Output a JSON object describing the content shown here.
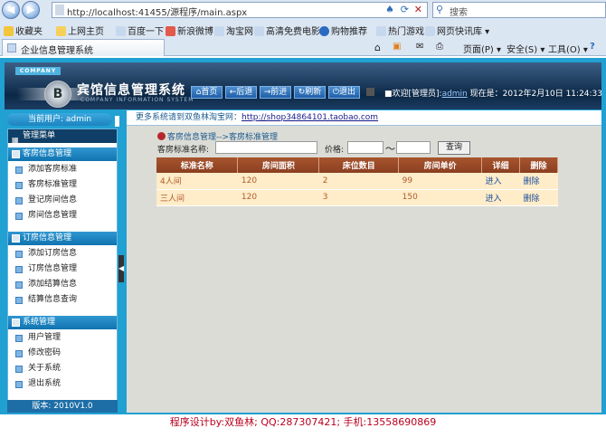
{
  "browser": {
    "url": "http://localhost:41455/源程序/main.aspx",
    "search_placeholder": "搜索",
    "bookmarks": [
      "收藏夹",
      "上网主页",
      "百度一下",
      "新浪微博",
      "淘宝网",
      "高清免费电影",
      "购物推荐",
      "热门游戏",
      "网页快讯库 ▾"
    ],
    "tab_title": "企业信息管理系统",
    "toolbar": [
      "页面(P) ▾",
      "安全(S) ▾",
      "工具(O) ▾"
    ]
  },
  "header": {
    "company": "COMPANY",
    "logo_letter": "B",
    "title": "宾馆信息管理系统",
    "subtitle": "COMPANY INFORMATION SYSTEM",
    "buttons": [
      "首页",
      "后退",
      "前进",
      "刷新",
      "退出"
    ],
    "welcome_prefix": "■欢迎[管理员]:",
    "welcome_user": "admin",
    "time": "现在是：2012年2月10日 11:24:33"
  },
  "sidebar": {
    "current_user": "当前用户: admin",
    "menu_title": "管理菜单",
    "groups": [
      {
        "title": "客房信息管理",
        "items": [
          "添加客房标准",
          "客房标准管理",
          "登记房间信息",
          "房间信息管理"
        ]
      },
      {
        "title": "订房信息管理",
        "items": [
          "添加订房信息",
          "订房信息管理",
          "添加结算信息",
          "结算信息查询"
        ]
      },
      {
        "title": "系统管理",
        "items": [
          "用户管理",
          "修改密码",
          "关于系统",
          "退出系统"
        ]
      }
    ],
    "version": "版本: 2010V1.0"
  },
  "notice": {
    "text": "更多系统请到双鱼林淘宝网：",
    "link": "http://shop34864101.taobao.com"
  },
  "main": {
    "breadcrumb": "客房信息管理-->客房标准管理",
    "search_label": "客房标准名称:",
    "price_label": "价格:",
    "tilde": "～",
    "query_button": "查询",
    "table": {
      "headers": [
        "标准名称",
        "房间面积",
        "床位数目",
        "房间单价",
        "详细",
        "删除"
      ],
      "rows": [
        [
          "4人间",
          "120",
          "2",
          "99",
          "进入",
          "删除"
        ],
        [
          "三人间",
          "120",
          "3",
          "150",
          "进入",
          "删除"
        ]
      ]
    }
  },
  "footer": "程序设计by:双鱼林;   QQ:287307421;   手机:13558690869"
}
